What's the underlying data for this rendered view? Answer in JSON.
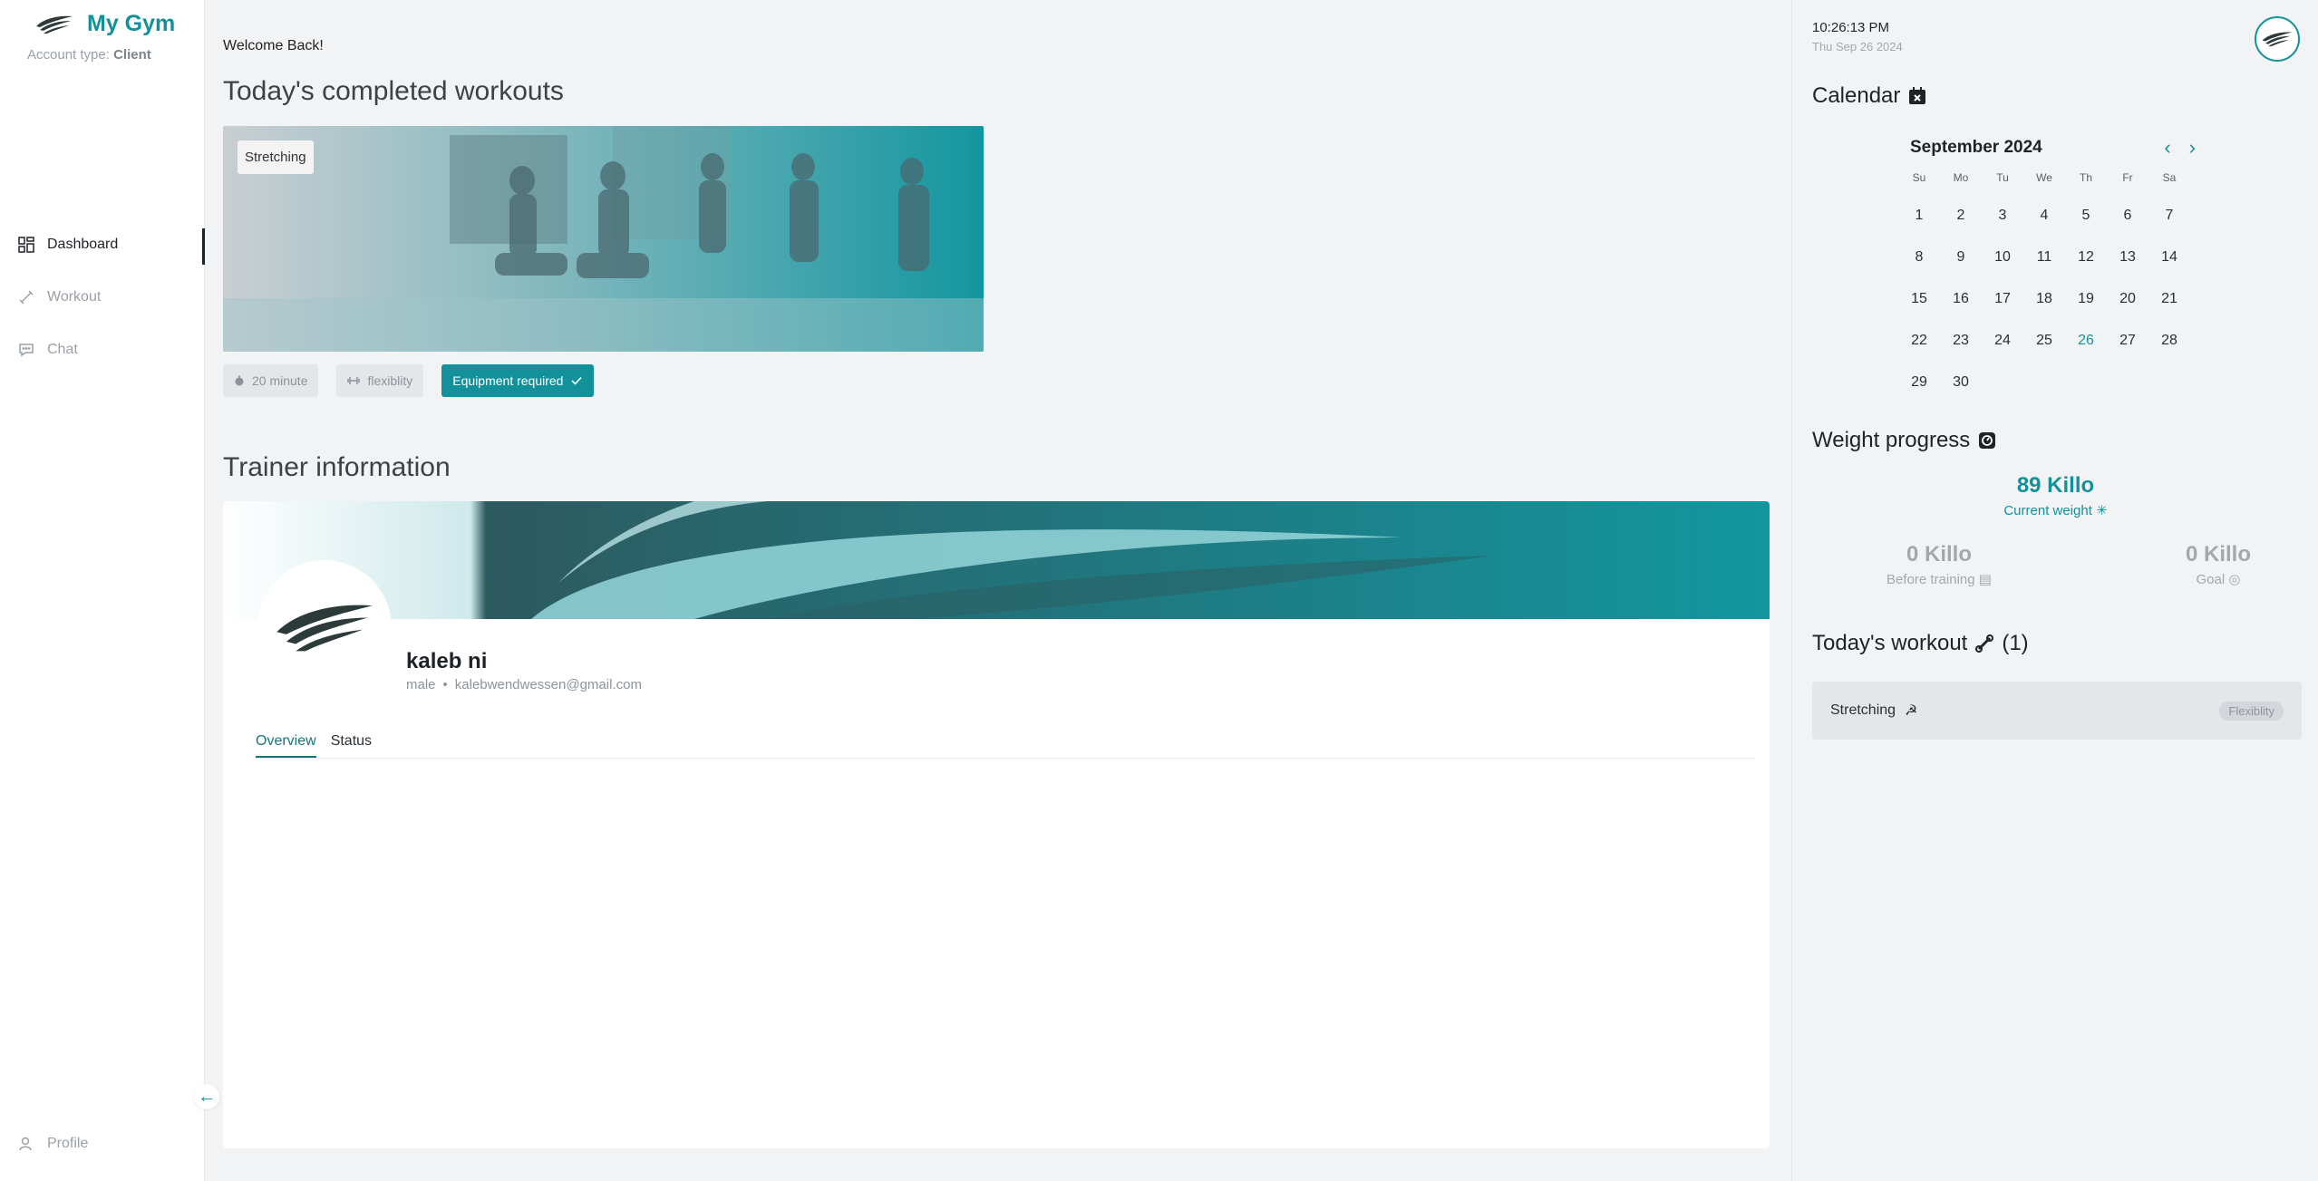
{
  "brand": {
    "name": "My Gym",
    "account_label": "Account type:",
    "account_type": "Client",
    "logo": "wing-logo"
  },
  "nav": {
    "items": [
      {
        "label": "Dashboard",
        "icon": "dashboard-icon",
        "active": true
      },
      {
        "label": "Workout",
        "icon": "dumbbell-icon",
        "active": false
      },
      {
        "label": "Chat",
        "icon": "chat-icon",
        "active": false
      }
    ],
    "profile_label": "Profile",
    "collapse_icon": "arrow-left-icon"
  },
  "main": {
    "welcome": "Welcome Back!",
    "completed_title": "Today's completed workouts",
    "workout_card": {
      "tag": "Stretching",
      "chips": [
        {
          "label": "20 minute",
          "icon": "timer-icon"
        },
        {
          "label": "flexiblity",
          "icon": "dumbbell-icon"
        },
        {
          "label": "Equipment required",
          "icon": "check-icon",
          "primary": true
        }
      ]
    },
    "trainer_title": "Trainer information",
    "trainer": {
      "name": "kaleb ni",
      "gender": "male",
      "separator": "•",
      "email": "kalebwendwessen@gmail.com",
      "tabs": [
        "Overview",
        "Status"
      ],
      "active_tab": "Overview"
    }
  },
  "right": {
    "time": "10:26:13 PM",
    "date": "Thu Sep 26 2024",
    "calendar": {
      "title": "Calendar",
      "month": "September 2024",
      "weekdays": [
        "Su",
        "Mo",
        "Tu",
        "We",
        "Th",
        "Fr",
        "Sa"
      ],
      "days": [
        "1",
        "2",
        "3",
        "4",
        "5",
        "6",
        "7",
        "8",
        "9",
        "10",
        "11",
        "12",
        "13",
        "14",
        "15",
        "16",
        "17",
        "18",
        "19",
        "20",
        "21",
        "22",
        "23",
        "24",
        "25",
        "26",
        "27",
        "28",
        "29",
        "30"
      ],
      "today": "26",
      "prev_icon": "chevron-left-icon",
      "next_icon": "chevron-right-icon"
    },
    "weight": {
      "title": "Weight progress",
      "current_value": "89 Killo",
      "current_label": "Current weight",
      "before_value": "0 Killo",
      "before_label": "Before training",
      "goal_value": "0 Killo",
      "goal_label": "Goal"
    },
    "today_workout": {
      "title": "Today's workout",
      "count": "(1)",
      "items": [
        {
          "name": "Stretching",
          "badge": "Flexiblity"
        }
      ]
    }
  },
  "colors": {
    "accent": "#13919b",
    "text": "#1f2328",
    "muted": "#9aa0a6",
    "background": "#f2f3f5"
  }
}
